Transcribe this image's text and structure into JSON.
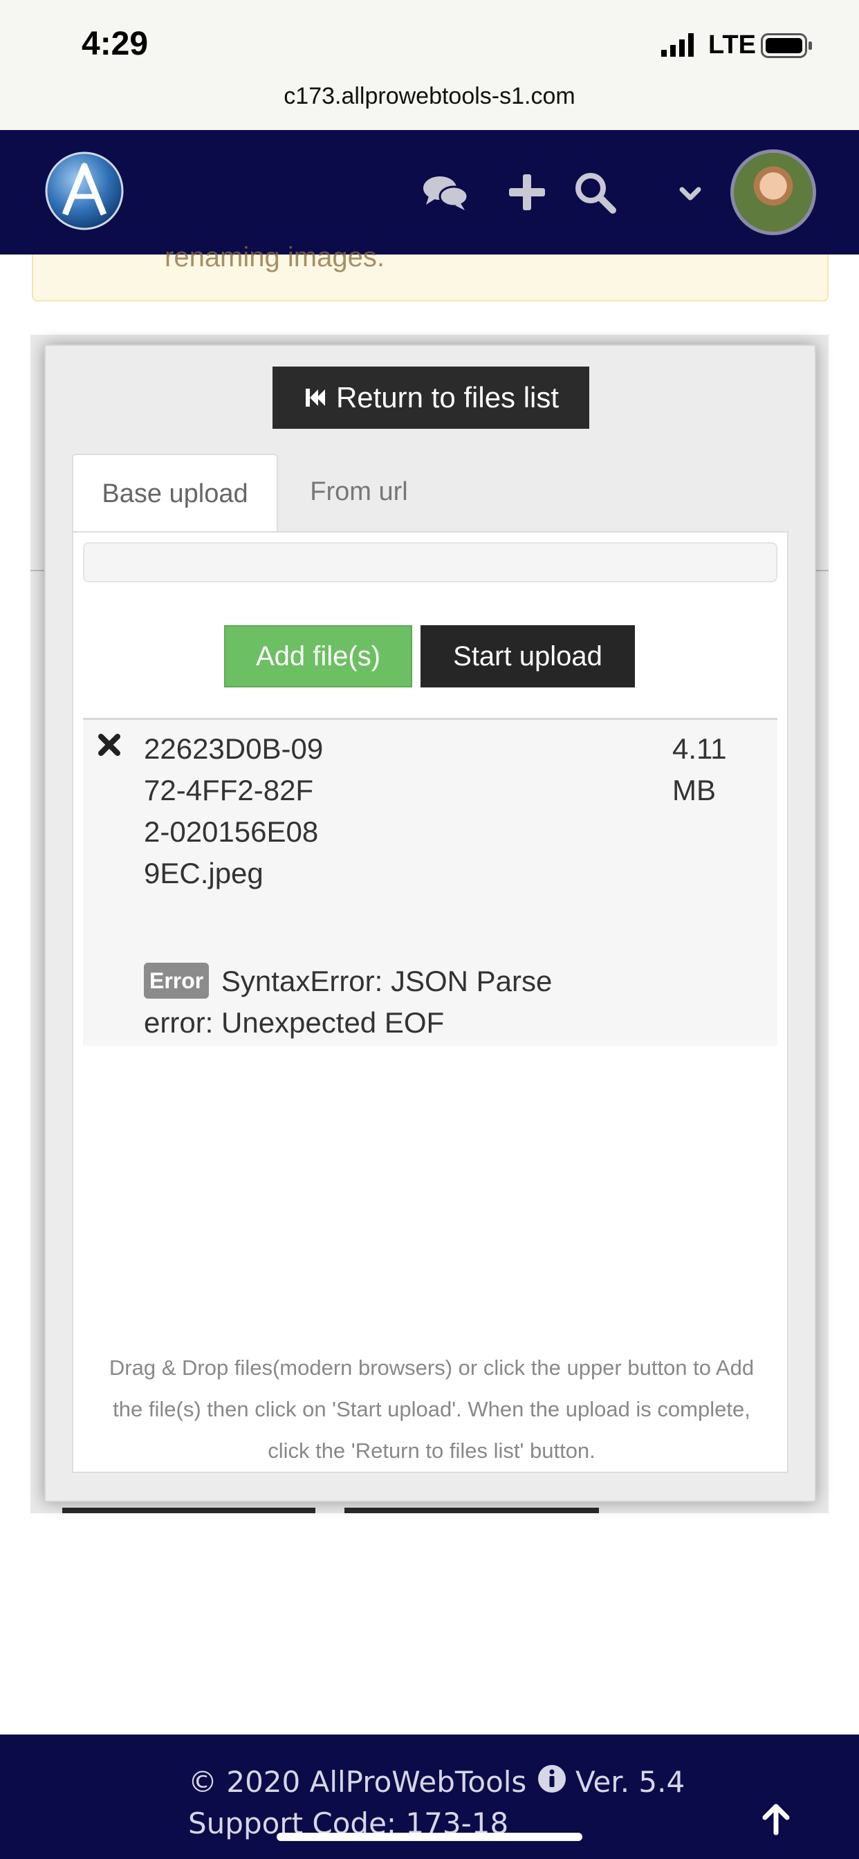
{
  "status_bar": {
    "time": "4:29",
    "network": "LTE",
    "url": "c173.allprowebtools-s1.com"
  },
  "header": {
    "logo_icon": "allprowebtools-logo-icon",
    "icons": [
      "chat-icon",
      "plus-icon",
      "search-icon",
      "chevron-down-icon"
    ],
    "avatar": "user-avatar"
  },
  "background": {
    "notice_text": "renaming images."
  },
  "upload_modal": {
    "return_label": "Return to files list",
    "tabs": [
      {
        "label": "Base upload",
        "active": true
      },
      {
        "label": "From url",
        "active": false
      }
    ],
    "add_files_label": "Add file(s)",
    "start_upload_label": "Start upload",
    "files": [
      {
        "name": "22623D0B-0972-4FF2-82F2-020156E089EC.jpeg",
        "size": "4.11 MB",
        "error_badge": "Error",
        "error_message": "SyntaxError: JSON Parse error: Unexpected EOF"
      }
    ],
    "help_text": "Drag & Drop files(modern browsers) or click the upper button to Add the file(s) then click on 'Start upload'. When the upload is complete, click the 'Return to files list' button."
  },
  "footer": {
    "copyright": "© 2020 AllProWebTools",
    "version": "Ver. 5.4",
    "support_code": "Support Code: 173-18"
  },
  "colors": {
    "brand_navy": "#0b0b4a",
    "add_green": "#6cbf63",
    "dark_button": "#2b2b2b",
    "error_badge": "#8b8b8b"
  }
}
